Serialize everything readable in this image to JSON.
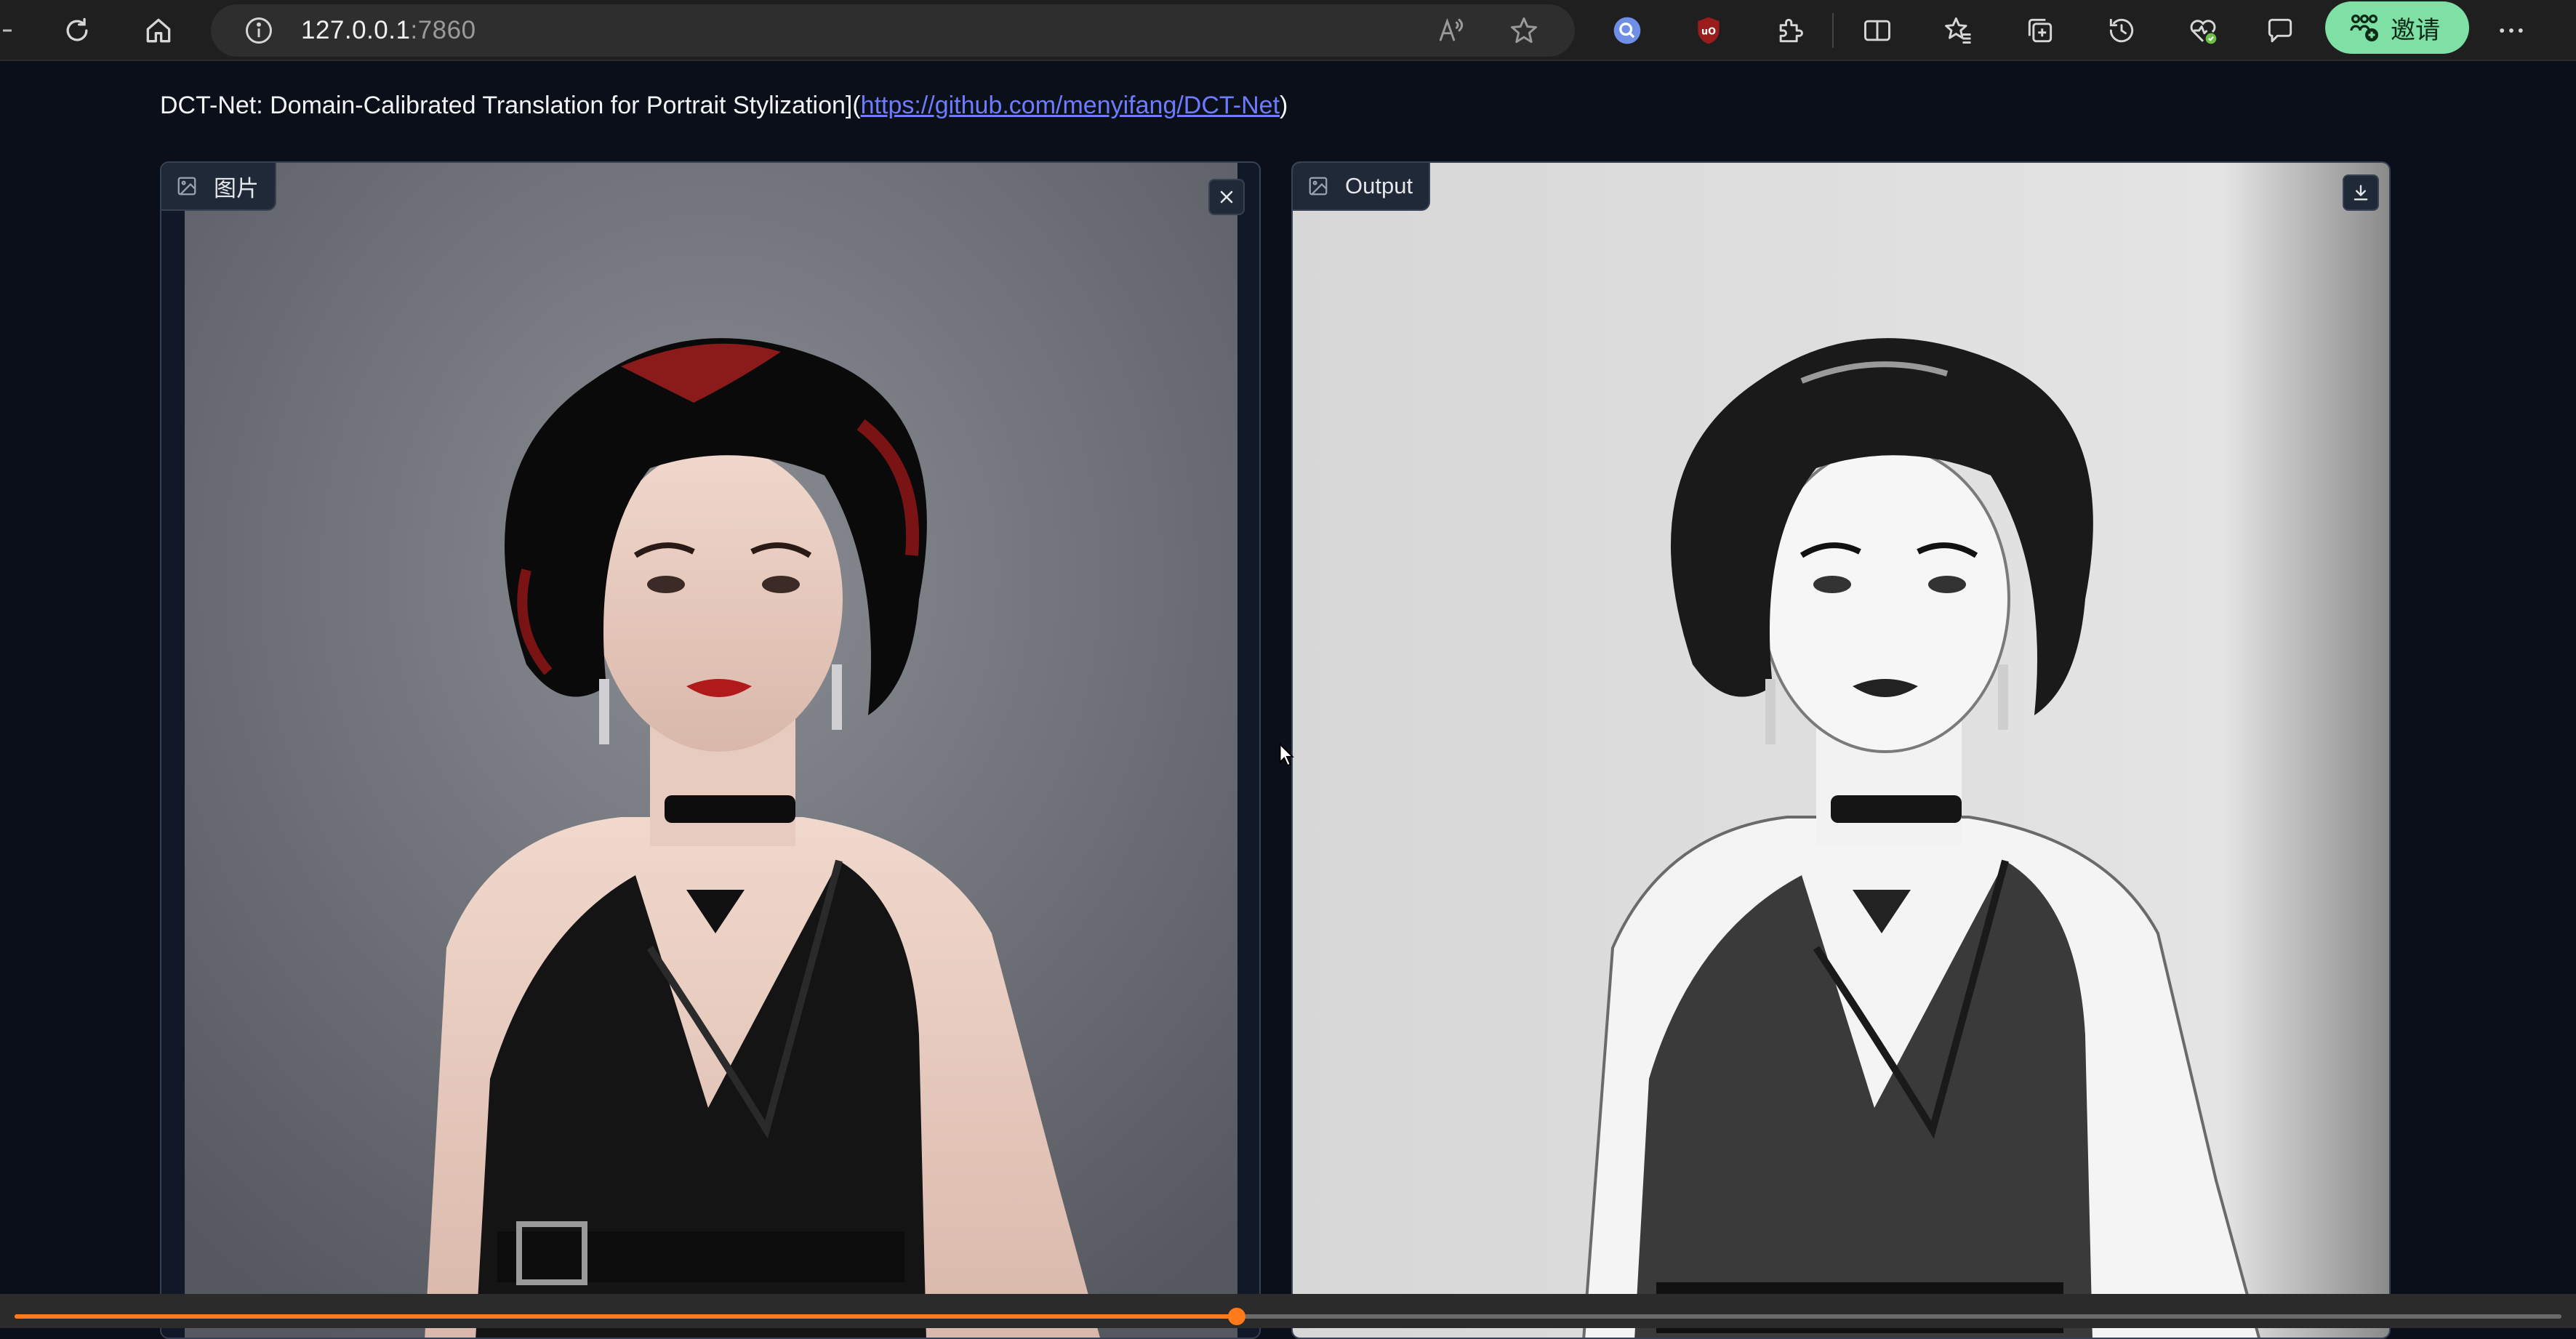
{
  "browser": {
    "url_host": "127.0.0.1",
    "url_port": ":7860",
    "invite_label": "邀请"
  },
  "page": {
    "heading_prefix": "DCT-Net: Domain-Calibrated Translation for Portrait Stylization](",
    "heading_link": "https://github.com/menyifang/DCT-Net",
    "heading_suffix": ")"
  },
  "input_panel": {
    "label": "图片"
  },
  "output_panel": {
    "label": "Output"
  },
  "playback": {
    "progress_fraction": 0.48
  },
  "icons": {
    "reload": "reload-icon",
    "home": "home-icon",
    "info": "info-icon",
    "read_aloud": "read-aloud-icon",
    "favorite": "star-icon",
    "extension": "puzzle-icon",
    "split": "split-screen-icon",
    "favorites": "favorites-icon",
    "collections": "collections-icon",
    "history": "history-icon",
    "health": "browser-essentials-icon",
    "copilot": "chat-icon",
    "more": "more-icon",
    "clear": "close-icon",
    "download": "download-icon",
    "image": "image-icon"
  },
  "colors": {
    "accent_orange": "#ff7a1a",
    "link_blue": "#6d7cff",
    "invite_green": "#7ee0a4",
    "page_bg": "#0b0f19"
  }
}
